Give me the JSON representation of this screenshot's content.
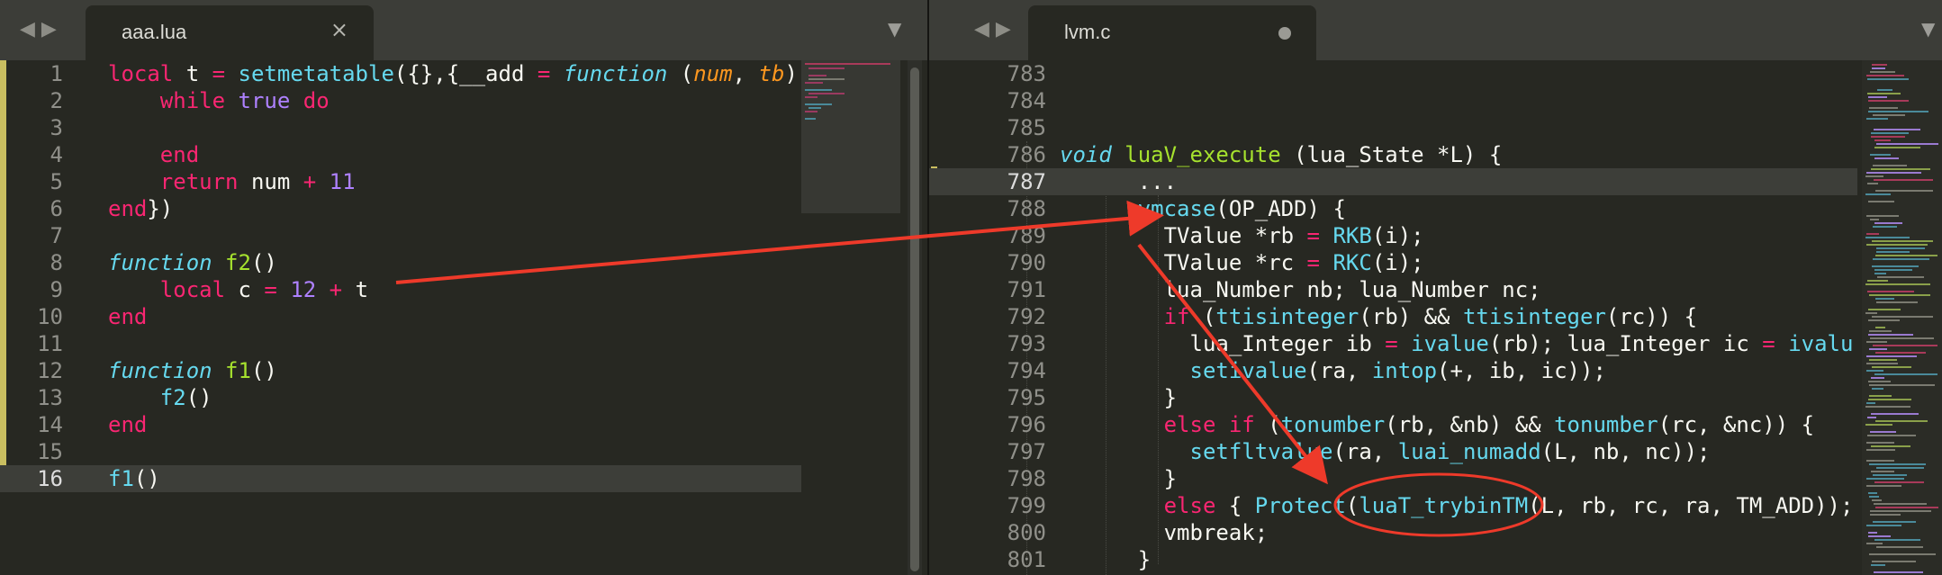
{
  "colors": {
    "annotation": "#ee3a2a",
    "background": "#272822",
    "keyword": "#f92672",
    "function": "#a6e22e",
    "builtin": "#66d9ef",
    "number": "#ae81ff",
    "parameter": "#fd971f"
  },
  "left_pane": {
    "nav_icon": "back-forward-icon",
    "nav_label": "◀ ▶",
    "tab_title": "aaa.lua",
    "tab_close": "×",
    "tab_dropdown": "▼",
    "lines": [
      {
        "n": "1",
        "tokens": [
          [
            "kw",
            "local"
          ],
          [
            "plain",
            " t "
          ],
          [
            "kw",
            "="
          ],
          [
            "plain",
            " "
          ],
          [
            "sfn",
            "setmetatable"
          ],
          [
            "plain",
            "({},{__add "
          ],
          [
            "kw",
            "="
          ],
          [
            "plain",
            " "
          ],
          [
            "type",
            "function"
          ],
          [
            "plain",
            " ("
          ],
          [
            "param",
            "num"
          ],
          [
            "plain",
            ", "
          ],
          [
            "param",
            "tb"
          ],
          [
            "plain",
            ")"
          ]
        ]
      },
      {
        "n": "2",
        "tokens": [
          [
            "plain",
            "    "
          ],
          [
            "kw",
            "while"
          ],
          [
            "plain",
            " "
          ],
          [
            "num",
            "true"
          ],
          [
            "plain",
            " "
          ],
          [
            "kw",
            "do"
          ]
        ]
      },
      {
        "n": "3",
        "tokens": []
      },
      {
        "n": "4",
        "tokens": [
          [
            "plain",
            "    "
          ],
          [
            "kw",
            "end"
          ]
        ]
      },
      {
        "n": "5",
        "tokens": [
          [
            "plain",
            "    "
          ],
          [
            "kw",
            "return"
          ],
          [
            "plain",
            " num "
          ],
          [
            "kw",
            "+"
          ],
          [
            "plain",
            " "
          ],
          [
            "num",
            "11"
          ]
        ]
      },
      {
        "n": "6",
        "tokens": [
          [
            "kw",
            "end"
          ],
          [
            "plain",
            "})"
          ]
        ]
      },
      {
        "n": "7",
        "tokens": []
      },
      {
        "n": "8",
        "tokens": [
          [
            "type",
            "function"
          ],
          [
            "plain",
            " "
          ],
          [
            "fn",
            "f2"
          ],
          [
            "plain",
            "()"
          ]
        ]
      },
      {
        "n": "9",
        "tokens": [
          [
            "plain",
            "    "
          ],
          [
            "kw",
            "local"
          ],
          [
            "plain",
            " c "
          ],
          [
            "kw",
            "="
          ],
          [
            "plain",
            " "
          ],
          [
            "num",
            "12"
          ],
          [
            "plain",
            " "
          ],
          [
            "kw",
            "+"
          ],
          [
            "plain",
            " t"
          ]
        ]
      },
      {
        "n": "10",
        "tokens": [
          [
            "kw",
            "end"
          ]
        ]
      },
      {
        "n": "11",
        "tokens": []
      },
      {
        "n": "12",
        "tokens": [
          [
            "type",
            "function"
          ],
          [
            "plain",
            " "
          ],
          [
            "fn",
            "f1"
          ],
          [
            "plain",
            "()"
          ]
        ]
      },
      {
        "n": "13",
        "tokens": [
          [
            "plain",
            "    "
          ],
          [
            "sfn",
            "f2"
          ],
          [
            "plain",
            "()"
          ]
        ]
      },
      {
        "n": "14",
        "tokens": [
          [
            "kw",
            "end"
          ]
        ]
      },
      {
        "n": "15",
        "tokens": []
      },
      {
        "n": "16",
        "tokens": [
          [
            "sfn",
            "f1"
          ],
          [
            "plain",
            "()"
          ]
        ],
        "active": true
      }
    ]
  },
  "right_pane": {
    "nav_icon": "back-forward-icon",
    "nav_label": "◀ ▶",
    "tab_title": "lvm.c",
    "tab_modified_icon": "unsaved-dot-icon",
    "tab_dropdown": "▼",
    "lines": [
      {
        "n": "783",
        "tokens": []
      },
      {
        "n": "784",
        "tokens": []
      },
      {
        "n": "785",
        "tokens": []
      },
      {
        "n": "786",
        "tokens": [
          [
            "type",
            "void"
          ],
          [
            "plain",
            " "
          ],
          [
            "fn",
            "luaV_execute"
          ],
          [
            "plain",
            " (lua_State *L) {"
          ]
        ]
      },
      {
        "n": "787",
        "tokens": [
          [
            "plain",
            "      ..."
          ]
        ],
        "active": true
      },
      {
        "n": "788",
        "tokens": [
          [
            "plain",
            "      "
          ],
          [
            "sfn",
            "vmcase"
          ],
          [
            "plain",
            "(OP_ADD) {"
          ]
        ]
      },
      {
        "n": "789",
        "tokens": [
          [
            "plain",
            "        TValue *rb "
          ],
          [
            "kw",
            "="
          ],
          [
            "plain",
            " "
          ],
          [
            "sfn",
            "RKB"
          ],
          [
            "plain",
            "(i);"
          ]
        ]
      },
      {
        "n": "790",
        "tokens": [
          [
            "plain",
            "        TValue *rc "
          ],
          [
            "kw",
            "="
          ],
          [
            "plain",
            " "
          ],
          [
            "sfn",
            "RKC"
          ],
          [
            "plain",
            "(i);"
          ]
        ]
      },
      {
        "n": "791",
        "tokens": [
          [
            "plain",
            "        lua_Number nb; lua_Number nc;"
          ]
        ]
      },
      {
        "n": "792",
        "tokens": [
          [
            "plain",
            "        "
          ],
          [
            "kw",
            "if"
          ],
          [
            "plain",
            " ("
          ],
          [
            "sfn",
            "ttisinteger"
          ],
          [
            "plain",
            "(rb) && "
          ],
          [
            "sfn",
            "ttisinteger"
          ],
          [
            "plain",
            "(rc)) {"
          ]
        ]
      },
      {
        "n": "793",
        "tokens": [
          [
            "plain",
            "          lua_Integer ib "
          ],
          [
            "kw",
            "="
          ],
          [
            "plain",
            " "
          ],
          [
            "sfn",
            "ivalue"
          ],
          [
            "plain",
            "(rb); lua_Integer ic "
          ],
          [
            "kw",
            "="
          ],
          [
            "plain",
            " "
          ],
          [
            "sfn",
            "ivalu"
          ]
        ]
      },
      {
        "n": "794",
        "tokens": [
          [
            "plain",
            "          "
          ],
          [
            "sfn",
            "setivalue"
          ],
          [
            "plain",
            "(ra, "
          ],
          [
            "sfn",
            "intop"
          ],
          [
            "plain",
            "(+, ib, ic));"
          ]
        ]
      },
      {
        "n": "795",
        "tokens": [
          [
            "plain",
            "        }"
          ]
        ]
      },
      {
        "n": "796",
        "tokens": [
          [
            "plain",
            "        "
          ],
          [
            "kw",
            "else"
          ],
          [
            "plain",
            " "
          ],
          [
            "kw",
            "if"
          ],
          [
            "plain",
            " ("
          ],
          [
            "sfn",
            "tonumber"
          ],
          [
            "plain",
            "(rb, &nb) && "
          ],
          [
            "sfn",
            "tonumber"
          ],
          [
            "plain",
            "(rc, &nc)) {"
          ]
        ]
      },
      {
        "n": "797",
        "tokens": [
          [
            "plain",
            "          "
          ],
          [
            "sfn",
            "setfltvalue"
          ],
          [
            "plain",
            "(ra, "
          ],
          [
            "sfn",
            "luai_numadd"
          ],
          [
            "plain",
            "(L, nb, nc));"
          ]
        ]
      },
      {
        "n": "798",
        "tokens": [
          [
            "plain",
            "        }"
          ]
        ]
      },
      {
        "n": "799",
        "tokens": [
          [
            "plain",
            "        "
          ],
          [
            "kw",
            "else"
          ],
          [
            "plain",
            " { "
          ],
          [
            "sfn",
            "Protect"
          ],
          [
            "plain",
            "("
          ],
          [
            "sfn",
            "luaT_trybinTM"
          ],
          [
            "plain",
            "(L, rb, rc, ra, TM_ADD));"
          ]
        ]
      },
      {
        "n": "800",
        "tokens": [
          [
            "plain",
            "        vmbreak;"
          ]
        ]
      },
      {
        "n": "801",
        "tokens": [
          [
            "plain",
            "      }"
          ]
        ]
      }
    ]
  }
}
